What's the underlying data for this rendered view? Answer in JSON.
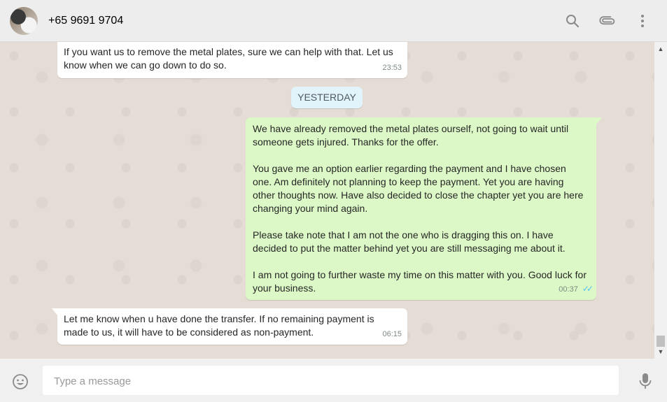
{
  "header": {
    "contact_name": "+65 9691 9704",
    "icons": [
      "search-icon",
      "attach-icon",
      "menu-icon"
    ]
  },
  "messages": [
    {
      "direction": "incoming",
      "text": "If you want us to remove the metal plates, sure we can help with that. Let us\nknow when we can go down to do so.",
      "time": "23:53"
    },
    {
      "direction": "outgoing",
      "text": "We have already removed the metal plates ourself, not going to wait until\nsomeone gets injured. Thanks for the offer.\n\nYou gave me an option earlier regarding the payment and I have chosen\none. Am definitely not planning to keep the payment. Yet you are having\nother thoughts now. Have also decided to close the chapter yet you are here\nchanging your mind again.\n\nPlease take note that I am not the one who is dragging this on. I have\ndecided to put the matter behind yet you are still messaging me about it.\n\nI am not going to further waste my time on this matter with you. Good luck for\nyour business.",
      "time": "00:37",
      "status": "read-double-tick-icon"
    },
    {
      "direction": "incoming",
      "text": "Let me know when u have done the transfer. If no remaining payment is\nmade to us, it will have to be considered as non-payment.",
      "time": "06:15"
    }
  ],
  "date_divider": "YESTERDAY",
  "composer": {
    "placeholder": "Type a message",
    "value": ""
  },
  "colors": {
    "header_bg": "#ededed",
    "chat_bg": "#e5ddd5",
    "outgoing_bubble": "#dcf8c6",
    "incoming_bubble": "#ffffff",
    "date_chip": "#e1f3fb",
    "read_tick": "#4fc3f7"
  }
}
